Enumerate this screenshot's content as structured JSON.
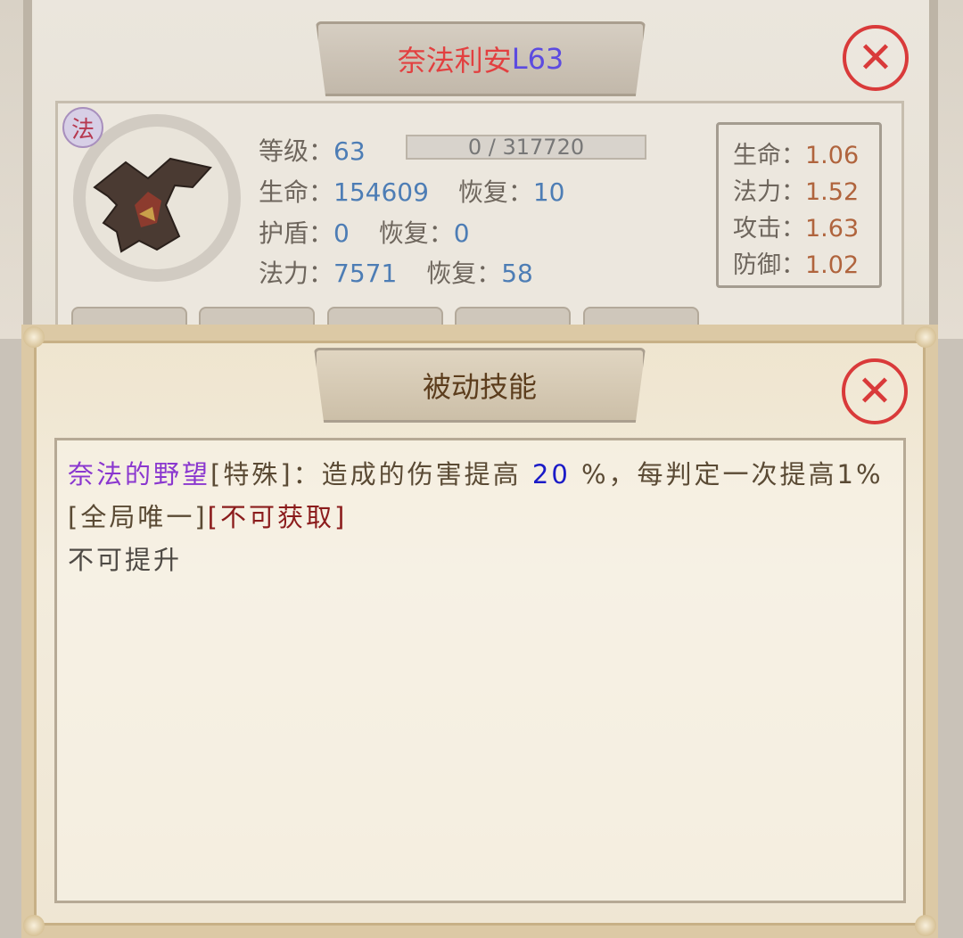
{
  "character": {
    "name": "奈法利安",
    "level_tag": "L63",
    "class_badge": "法",
    "level_label": "等级：",
    "level_value": "63",
    "exp_text": "0 / 317720",
    "hp_label": "生命：",
    "hp_value": "154609",
    "hp_regen_label": "恢复：",
    "hp_regen_value": "10",
    "shield_label": "护盾：",
    "shield_value": "0",
    "shield_regen_label": "恢复：",
    "shield_regen_value": "0",
    "mp_label": "法力：",
    "mp_value": "7571",
    "mp_regen_label": "恢复：",
    "mp_regen_value": "58"
  },
  "growth": [
    {
      "label": "生命：",
      "value": "1.06"
    },
    {
      "label": "法力：",
      "value": "1.52"
    },
    {
      "label": "攻击：",
      "value": "1.63"
    },
    {
      "label": "防御：",
      "value": "1.02"
    }
  ],
  "skill_panel": {
    "title": "被动技能",
    "skill_name": "奈法的野望",
    "desc_part1": "[特殊]：造成的伤害提高 ",
    "value": "20",
    "desc_part2": " %，每判定一次提高1%[全局唯一]",
    "unobtainable": "[不可获取]",
    "upgrade_status": "不可提升"
  },
  "colors": {
    "name_red": "#e24040",
    "level_blue": "#5c4be0",
    "stat_value": "#4d7db5",
    "growth_value": "#b0643d",
    "skill_purple": "#8a37cf",
    "close_red": "#d93a3a"
  },
  "icons": {
    "close": "close-icon",
    "class_badge": "mage-badge-icon"
  }
}
